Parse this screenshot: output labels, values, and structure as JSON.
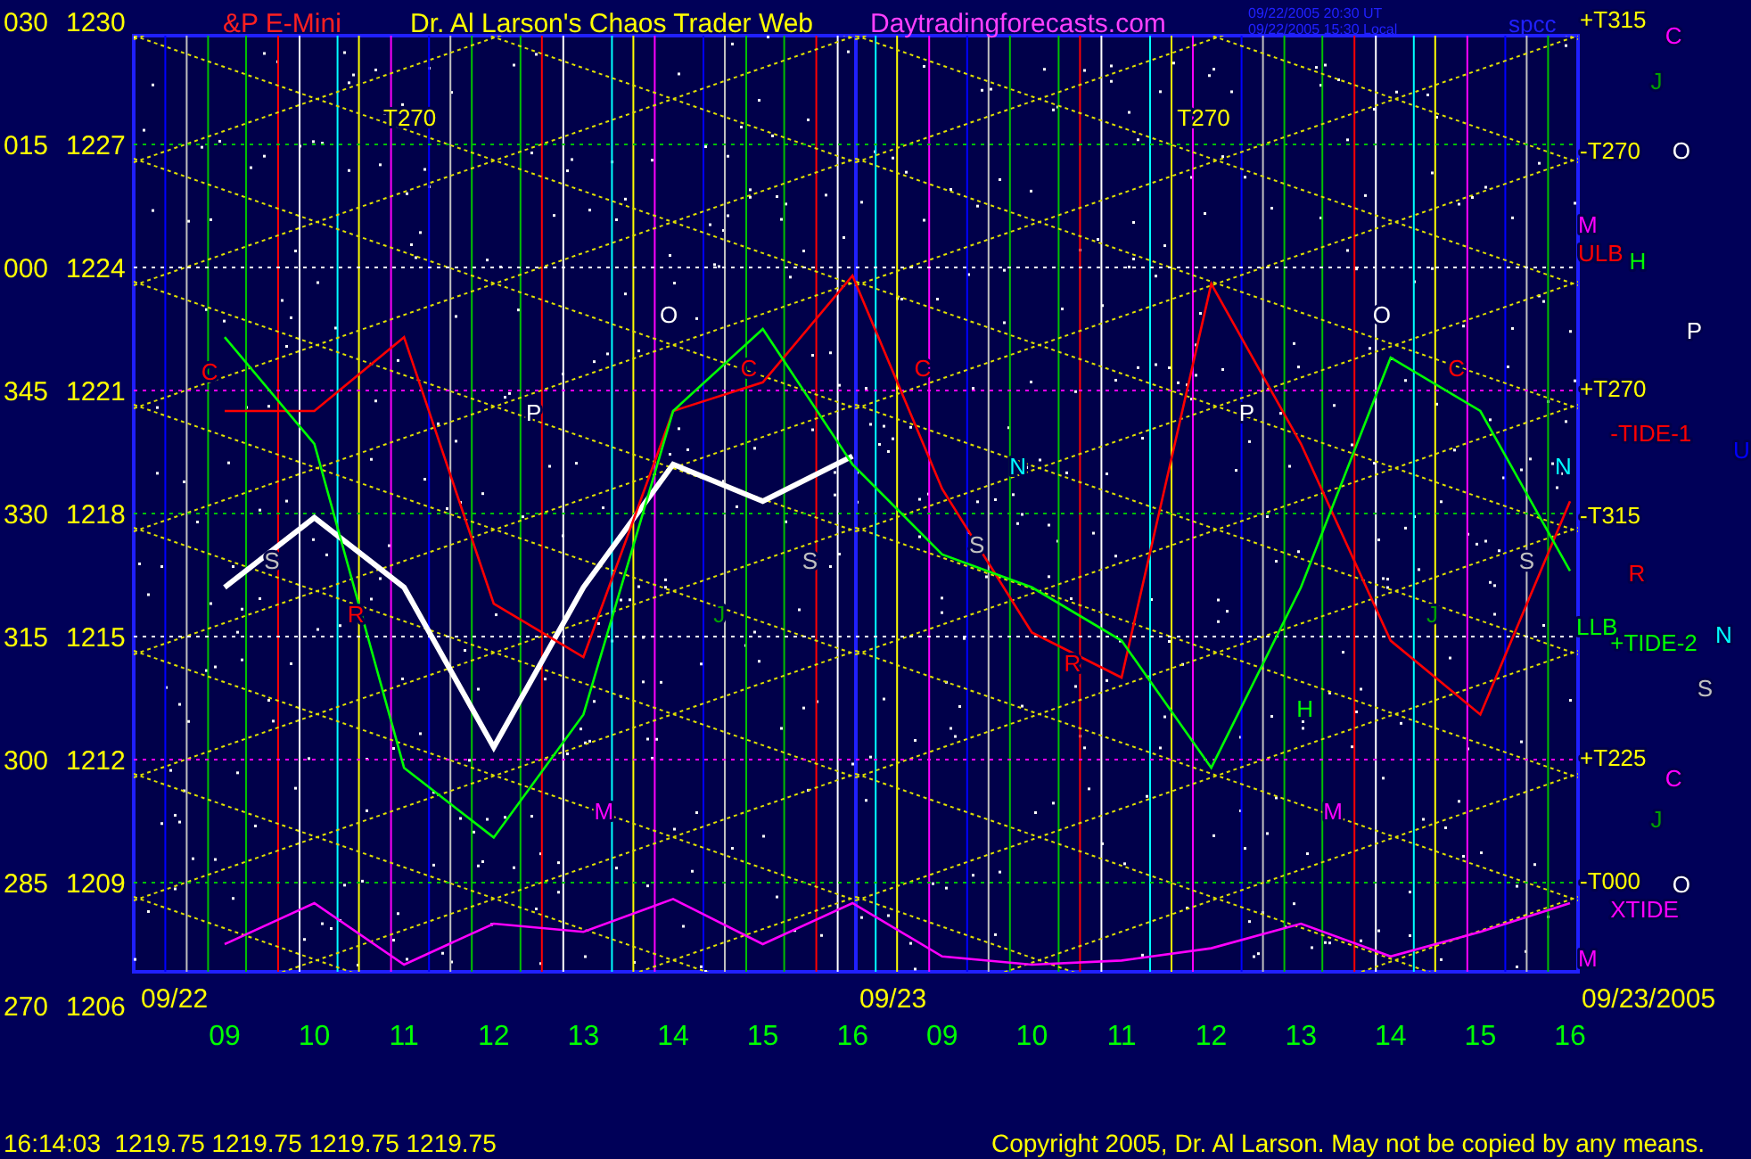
{
  "header": {
    "symbol": "&P E-Mini",
    "title": "Dr. Al Larson's Chaos Trader Web",
    "site": "Daytradingforecasts.com",
    "time_ut": "09/22/2005 20:30 UT",
    "time_local": "09/22/2005 15:30 Local",
    "file": "spcc"
  },
  "chart": {
    "chart_data": {
      "type": "line",
      "categories": [
        "09",
        "10",
        "11",
        "12",
        "13",
        "14",
        "15",
        "16",
        "09",
        "10",
        "11",
        "12",
        "13",
        "14",
        "15",
        "16"
      ],
      "ylim": [
        1206,
        1230
      ],
      "grid": true,
      "yticks": [
        1230,
        1227,
        1224,
        1221,
        1218,
        1215,
        1212,
        1209,
        1206
      ],
      "series": [
        {
          "color": "#ffffff",
          "values": [
            1216.2,
            1217.9,
            1216.2,
            1212.3,
            1216.2,
            1219.2,
            1218.3,
            1219.4,
            null,
            null,
            null,
            null,
            null,
            null,
            null,
            null
          ]
        },
        {
          "color": "#ff0000",
          "values": [
            1220.5,
            1220.5,
            1222.3,
            1215.8,
            1214.5,
            1220.5,
            1221.2,
            1223.8,
            1218.6,
            1215.1,
            1214.0,
            1223.6,
            1219.7,
            1214.9,
            1213.1,
            1218.3
          ]
        },
        {
          "color": "#00ff00",
          "values": [
            1222.3,
            1219.7,
            1211.8,
            1210.1,
            1213.1,
            1220.5,
            1222.5,
            1219.2,
            1217.0,
            1216.2,
            1214.9,
            1211.8,
            1216.2,
            1221.8,
            1220.5,
            1216.6
          ]
        },
        {
          "color": "#ff00ff",
          "values": [
            1207.5,
            1208.5,
            1207.0,
            1208.0,
            1207.8,
            1208.6,
            1207.5,
            1208.5,
            1207.2,
            1207.0,
            1207.1,
            1207.4,
            1208.0,
            1207.2,
            1207.8,
            1208.5
          ]
        }
      ]
    },
    "degree_labels": [
      "030",
      "015",
      "000",
      "345",
      "330",
      "315",
      "300",
      "285",
      "270"
    ],
    "day_labels": [
      "09/22",
      "09/23",
      "09/23/2005"
    ],
    "markers": [
      {
        "text": "T270",
        "color": "#ffff00"
      },
      {
        "text": "T270",
        "color": "#ffff00"
      },
      {
        "text": "O",
        "color": "#ffffff"
      },
      {
        "text": "O",
        "color": "#ffffff"
      },
      {
        "text": "C",
        "color": "#ff0000"
      },
      {
        "text": "P",
        "color": "#ffffff"
      },
      {
        "text": "C",
        "color": "#ff0000"
      },
      {
        "text": "C",
        "color": "#ff0000"
      },
      {
        "text": "P",
        "color": "#ffffff"
      },
      {
        "text": "C",
        "color": "#ff0000"
      },
      {
        "text": "N",
        "color": "#00ffff"
      },
      {
        "text": "S",
        "color": "#c0c0c0"
      },
      {
        "text": "S",
        "color": "#c0c0c0"
      },
      {
        "text": "S",
        "color": "#c0c0c0"
      },
      {
        "text": "S",
        "color": "#c0c0c0"
      },
      {
        "text": "R",
        "color": "#ff0000"
      },
      {
        "text": "J",
        "color": "#00a000"
      },
      {
        "text": "R",
        "color": "#ff0000"
      },
      {
        "text": "J",
        "color": "#00a000"
      },
      {
        "text": "H",
        "color": "#00ff00"
      },
      {
        "text": "M",
        "color": "#ff00ff"
      },
      {
        "text": "M",
        "color": "#ff00ff"
      },
      {
        "text": "+T315",
        "color": "#ffff00"
      },
      {
        "text": "C",
        "color": "#ff00ff"
      },
      {
        "text": "J",
        "color": "#00a000"
      },
      {
        "text": "-T270",
        "color": "#ffff00"
      },
      {
        "text": "O",
        "color": "#ffffff"
      },
      {
        "text": "M",
        "color": "#ff00ff"
      },
      {
        "text": "ULB",
        "color": "#ff0000"
      },
      {
        "text": "H",
        "color": "#00ff00"
      },
      {
        "text": "P",
        "color": "#ffffff"
      },
      {
        "text": "+T270",
        "color": "#ffff00"
      },
      {
        "text": "-TIDE-1",
        "color": "#ff0000"
      },
      {
        "text": "U",
        "color": "#0000ff"
      },
      {
        "text": "N",
        "color": "#00ffff"
      },
      {
        "text": "-T315",
        "color": "#ffff00"
      },
      {
        "text": "R",
        "color": "#ff0000"
      },
      {
        "text": "LLB",
        "color": "#00ff00"
      },
      {
        "text": "+TIDE-2",
        "color": "#00ff00"
      },
      {
        "text": "N",
        "color": "#00ffff"
      },
      {
        "text": "S",
        "color": "#c0c0c0"
      },
      {
        "text": "+T225",
        "color": "#ffff00"
      },
      {
        "text": "C",
        "color": "#ff00ff"
      },
      {
        "text": "J",
        "color": "#00a000"
      },
      {
        "text": "-T000",
        "color": "#ffff00"
      },
      {
        "text": "O",
        "color": "#ffffff"
      },
      {
        "text": "XTIDE",
        "color": "#ff00ff"
      },
      {
        "text": "M",
        "color": "#ff00ff"
      }
    ]
  },
  "status": {
    "quote": "16:14:03  1219.75 1219.75 1219.75 1219.75",
    "copyright": "Copyright 2005, Dr. Al Larson. May not be copied by any means."
  }
}
